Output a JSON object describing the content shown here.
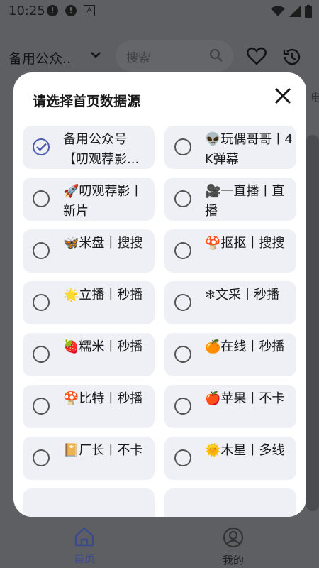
{
  "status_bar": {
    "time": "10:25"
  },
  "header": {
    "source_name": "备用公众..",
    "search_placeholder": "搜索",
    "side_label": "电"
  },
  "bottom_nav": [
    {
      "label": "首页",
      "active": true
    },
    {
      "label": "我的",
      "active": false
    }
  ],
  "dialog": {
    "title": "请选择首页数据源",
    "options": [
      {
        "label": "备用公众号【叨观荐影...",
        "selected": true
      },
      {
        "label": "👽玩偶哥哥丨4K弹幕",
        "selected": false
      },
      {
        "label": "🚀叨观荐影丨新片",
        "selected": false
      },
      {
        "label": "🎥一直播丨直播",
        "selected": false
      },
      {
        "label": "🦋米盘丨搜搜",
        "selected": false
      },
      {
        "label": "🍄抠抠丨搜搜",
        "selected": false
      },
      {
        "label": "🌟立播丨秒播",
        "selected": false
      },
      {
        "label": "❄文采丨秒播",
        "selected": false
      },
      {
        "label": "🍓糯米丨秒播",
        "selected": false
      },
      {
        "label": "🍊在线丨秒播",
        "selected": false
      },
      {
        "label": "🍄比特丨秒播",
        "selected": false
      },
      {
        "label": "🍎苹果丨不卡",
        "selected": false
      },
      {
        "label": "📔厂长丨不卡",
        "selected": false
      },
      {
        "label": "🌞木星丨多线",
        "selected": false
      }
    ]
  },
  "colors": {
    "accent": "#4e5cb0",
    "overlay_bg": "#5d5f63",
    "option_bg": "#eff0f6"
  }
}
